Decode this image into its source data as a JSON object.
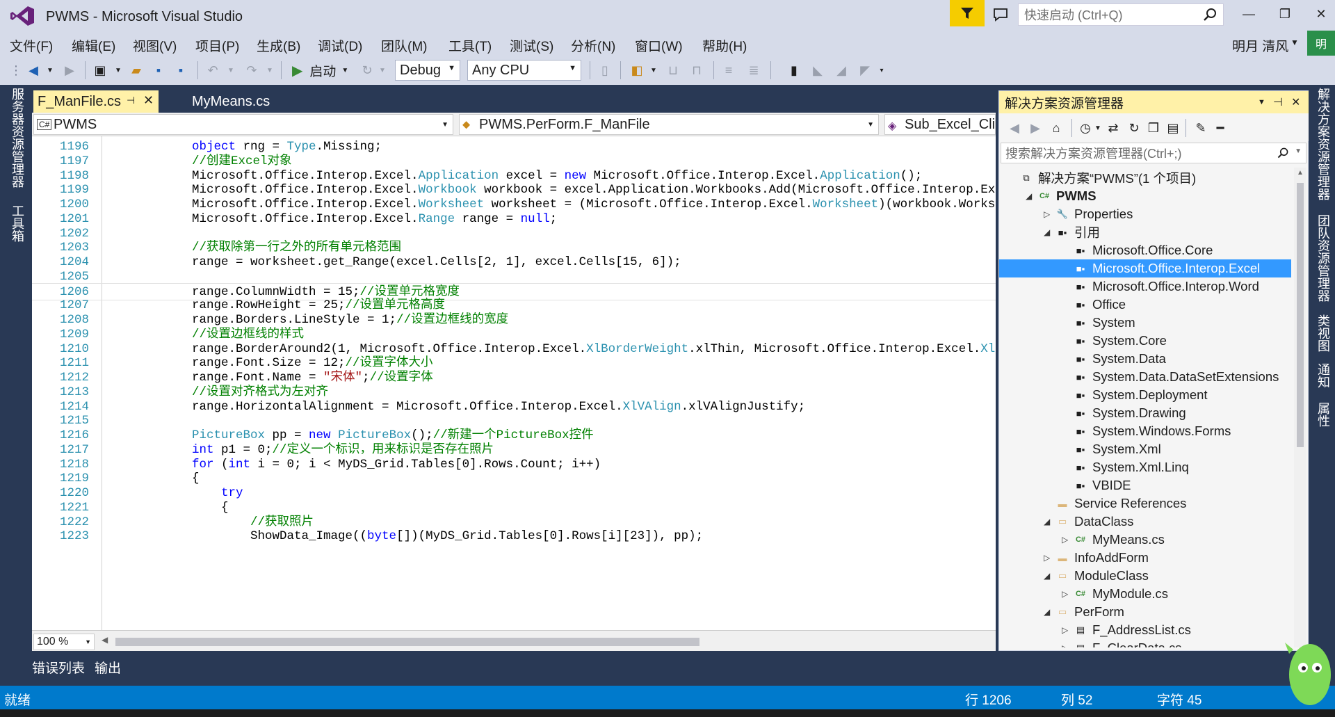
{
  "window": {
    "title": "PWMS - Microsoft Visual Studio",
    "quick_launch_placeholder": "快速启动 (Ctrl+Q)",
    "user": "明月 清风",
    "avatar_badge": "明"
  },
  "menu": [
    "文件(F)",
    "编辑(E)",
    "视图(V)",
    "项目(P)",
    "生成(B)",
    "调试(D)",
    "团队(M)",
    "工具(T)",
    "测试(S)",
    "分析(N)",
    "窗口(W)",
    "帮助(H)"
  ],
  "toolbar": {
    "start_label": "启动",
    "config": "Debug",
    "platform": "Any CPU"
  },
  "left_strip": [
    "服务器资源管理器",
    "工具箱"
  ],
  "tabs": {
    "active": "F_ManFile.cs",
    "inactive": "MyMeans.cs"
  },
  "nav": {
    "project": "PWMS",
    "class": "PWMS.PerForm.F_ManFile",
    "member": "Sub_Excel_Click"
  },
  "code_lines": [
    {
      "n": "1196",
      "html": "<span class=\"kw\">object</span> rng = <span class=\"ty\">Type</span>.Missing;"
    },
    {
      "n": "1197",
      "html": "<span class=\"cm\">//创建Excel对象</span>"
    },
    {
      "n": "1198",
      "html": "Microsoft.Office.Interop.Excel.<span class=\"ty\">Application</span> excel = <span class=\"kw\">new</span> Microsoft.Office.Interop.Excel.<span class=\"ty\">Application</span>();"
    },
    {
      "n": "1199",
      "html": "Microsoft.Office.Interop.Excel.<span class=\"ty\">Workbook</span> workbook = excel.Application.Workbooks.Add(Microsoft.Office.Interop.Excel.<span class=\"ty\">Xl</span>"
    },
    {
      "n": "1200",
      "html": "Microsoft.Office.Interop.Excel.<span class=\"ty\">Worksheet</span> worksheet = (Microsoft.Office.Interop.Excel.<span class=\"ty\">Worksheet</span>)(workbook.Worksheets["
    },
    {
      "n": "1201",
      "html": "Microsoft.Office.Interop.Excel.<span class=\"ty\">Range</span> range = <span class=\"kw\">null</span>;"
    },
    {
      "n": "1202",
      "html": ""
    },
    {
      "n": "1203",
      "html": "<span class=\"cm\">//获取除第一行之外的所有单元格范围</span>"
    },
    {
      "n": "1204",
      "html": "range = worksheet.get_Range(excel.Cells[2, 1], excel.Cells[15, 6]);"
    },
    {
      "n": "1205",
      "html": ""
    },
    {
      "n": "1206",
      "html": "range.ColumnWidth = 15;<span class=\"cm\">//设置单元格宽度</span>"
    },
    {
      "n": "1207",
      "html": "range.RowHeight = 25;<span class=\"cm\">//设置单元格高度</span>"
    },
    {
      "n": "1208",
      "html": "range.Borders.LineStyle = 1;<span class=\"cm\">//设置边框线的宽度</span>"
    },
    {
      "n": "1209",
      "html": "<span class=\"cm\">//设置边框线的样式</span>"
    },
    {
      "n": "1210",
      "html": "range.BorderAround2(1, Microsoft.Office.Interop.Excel.<span class=\"ty\">XlBorderWeight</span>.xlThin, Microsoft.Office.Interop.Excel.<span class=\"ty\">XlColorI</span>"
    },
    {
      "n": "1211",
      "html": "range.Font.Size = 12;<span class=\"cm\">//设置字体大小</span>"
    },
    {
      "n": "1212",
      "html": "range.Font.Name = <span class=\"st\">\"宋体\"</span>;<span class=\"cm\">//设置字体</span>"
    },
    {
      "n": "1213",
      "html": "<span class=\"cm\">//设置对齐格式为左对齐</span>"
    },
    {
      "n": "1214",
      "html": "range.HorizontalAlignment = Microsoft.Office.Interop.Excel.<span class=\"ty\">XlVAlign</span>.xlVAlignJustify;"
    },
    {
      "n": "1215",
      "html": ""
    },
    {
      "n": "1216",
      "html": "<span class=\"ty\">PictureBox</span> pp = <span class=\"kw\">new</span> <span class=\"ty\">PictureBox</span>();<span class=\"cm\">//新建一个PictureBox控件</span>"
    },
    {
      "n": "1217",
      "html": "<span class=\"kw\">int</span> p1 = 0;<span class=\"cm\">//定义一个标识，用来标识是否存在照片</span>"
    },
    {
      "n": "1218",
      "html": "<span class=\"kw\">for</span> (<span class=\"kw\">int</span> i = 0; i &lt; MyDS_Grid.Tables[0].Rows.Count; i++)"
    },
    {
      "n": "1219",
      "html": "{"
    },
    {
      "n": "1220",
      "html": "    <span class=\"kw\">try</span>"
    },
    {
      "n": "1221",
      "html": "    {"
    },
    {
      "n": "1222",
      "html": "        <span class=\"cm\">//获取照片</span>"
    },
    {
      "n": "1223",
      "html": "        ShowData_Image((<span class=\"kw\">byte</span>[])(MyDS_Grid.Tables[0].Rows[i][23]), pp);"
    }
  ],
  "zoom": "100 %",
  "bottom_tabs": [
    "错误列表",
    "输出"
  ],
  "status": {
    "ready": "就绪",
    "line": "行 1206",
    "col": "列 52",
    "char": "字符 45"
  },
  "solution_explorer": {
    "title": "解决方案资源管理器",
    "search_placeholder": "搜索解决方案资源管理器(Ctrl+;)",
    "items": [
      {
        "label": "解决方案“PWMS”(1 个项目)",
        "indent": 0,
        "icon": "solution-icon",
        "arrow": "",
        "bold": false
      },
      {
        "label": "PWMS",
        "indent": 1,
        "icon": "csharp-project-icon",
        "arrow": "open",
        "bold": true
      },
      {
        "label": "Properties",
        "indent": 2,
        "icon": "wrench-icon",
        "arrow": "closed",
        "bold": false
      },
      {
        "label": "引用",
        "indent": 2,
        "icon": "references-icon",
        "arrow": "open",
        "bold": false
      },
      {
        "label": "Microsoft.Office.Core",
        "indent": 3,
        "icon": "reference-icon",
        "arrow": "",
        "bold": false
      },
      {
        "label": "Microsoft.Office.Interop.Excel",
        "indent": 3,
        "icon": "reference-icon",
        "arrow": "",
        "bold": false,
        "selected": true
      },
      {
        "label": "Microsoft.Office.Interop.Word",
        "indent": 3,
        "icon": "reference-icon",
        "arrow": "",
        "bold": false
      },
      {
        "label": "Office",
        "indent": 3,
        "icon": "reference-icon",
        "arrow": "",
        "bold": false
      },
      {
        "label": "System",
        "indent": 3,
        "icon": "reference-icon",
        "arrow": "",
        "bold": false
      },
      {
        "label": "System.Core",
        "indent": 3,
        "icon": "reference-icon",
        "arrow": "",
        "bold": false
      },
      {
        "label": "System.Data",
        "indent": 3,
        "icon": "reference-icon",
        "arrow": "",
        "bold": false
      },
      {
        "label": "System.Data.DataSetExtensions",
        "indent": 3,
        "icon": "reference-icon",
        "arrow": "",
        "bold": false
      },
      {
        "label": "System.Deployment",
        "indent": 3,
        "icon": "reference-icon",
        "arrow": "",
        "bold": false
      },
      {
        "label": "System.Drawing",
        "indent": 3,
        "icon": "reference-icon",
        "arrow": "",
        "bold": false
      },
      {
        "label": "System.Windows.Forms",
        "indent": 3,
        "icon": "reference-icon",
        "arrow": "",
        "bold": false
      },
      {
        "label": "System.Xml",
        "indent": 3,
        "icon": "reference-icon",
        "arrow": "",
        "bold": false
      },
      {
        "label": "System.Xml.Linq",
        "indent": 3,
        "icon": "reference-icon",
        "arrow": "",
        "bold": false
      },
      {
        "label": "VBIDE",
        "indent": 3,
        "icon": "reference-icon",
        "arrow": "",
        "bold": false
      },
      {
        "label": "Service References",
        "indent": 2,
        "icon": "folder-icon",
        "arrow": "",
        "bold": false
      },
      {
        "label": "DataClass",
        "indent": 2,
        "icon": "folder-open-icon",
        "arrow": "open",
        "bold": false
      },
      {
        "label": "MyMeans.cs",
        "indent": 3,
        "icon": "csharp-file-icon",
        "arrow": "closed",
        "bold": false
      },
      {
        "label": "InfoAddForm",
        "indent": 2,
        "icon": "folder-icon",
        "arrow": "closed",
        "bold": false
      },
      {
        "label": "ModuleClass",
        "indent": 2,
        "icon": "folder-open-icon",
        "arrow": "open",
        "bold": false
      },
      {
        "label": "MyModule.cs",
        "indent": 3,
        "icon": "csharp-file-icon",
        "arrow": "closed",
        "bold": false
      },
      {
        "label": "PerForm",
        "indent": 2,
        "icon": "folder-open-icon",
        "arrow": "open",
        "bold": false
      },
      {
        "label": "F_AddressList.cs",
        "indent": 3,
        "icon": "form-icon",
        "arrow": "closed",
        "bold": false
      },
      {
        "label": "F_ClearData.cs",
        "indent": 3,
        "icon": "form-icon",
        "arrow": "closed",
        "bold": false
      }
    ]
  },
  "right_strip": [
    "解决方案资源管理器",
    "团队资源管理器",
    "类视图",
    "通知",
    "属性"
  ],
  "colors": {
    "frame": "#293955",
    "accent_tab": "#fff1a8",
    "status": "#007acc",
    "selection": "#3399ff"
  }
}
